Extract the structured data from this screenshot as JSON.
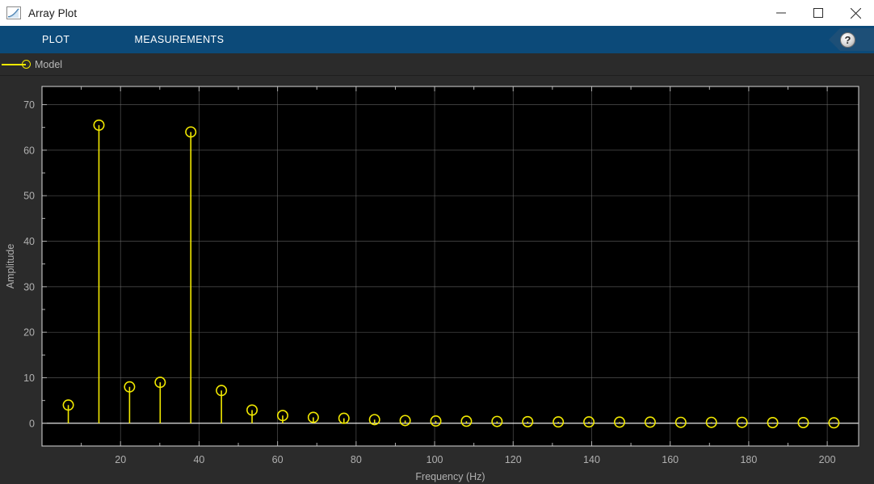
{
  "window": {
    "title": "Array Plot",
    "icon": "plot-curve-icon",
    "controls": {
      "minimize": "minimize-icon",
      "maximize": "maximize-icon",
      "close": "close-icon"
    }
  },
  "toolstrip": {
    "background": "#0c4a79",
    "tabs": [
      {
        "id": "plot",
        "label": "PLOT"
      },
      {
        "id": "measurements",
        "label": "MEASUREMENTS"
      }
    ],
    "help": {
      "icon": "help-question-icon",
      "label": "?"
    }
  },
  "legend": {
    "entries": [
      {
        "label": "Model",
        "color": "#f2e900",
        "marker": "circle"
      }
    ]
  },
  "chart_data": {
    "type": "line",
    "style": "stem",
    "title": "",
    "xlabel": "Frequency (Hz)",
    "ylabel": "Amplitude",
    "xlim": [
      0,
      208
    ],
    "ylim": [
      -5,
      74
    ],
    "grid": true,
    "legend_position": "top-left",
    "background": "#000000",
    "axis_background": "#2b2b2b",
    "grid_color": "#6e6e6e",
    "series_color": "#f2e900",
    "baseline_color": "#ffffff",
    "xticks": [
      20,
      40,
      60,
      80,
      100,
      120,
      140,
      160,
      180,
      200
    ],
    "xminor_step": 10,
    "yticks": [
      0,
      10,
      20,
      30,
      40,
      50,
      60,
      70
    ],
    "yminor_step": 5,
    "series": [
      {
        "name": "Model",
        "x": [
          6.7,
          14.5,
          22.3,
          30.1,
          37.9,
          45.7,
          53.5,
          61.3,
          69.1,
          76.9,
          84.7,
          92.5,
          100.3,
          108.1,
          115.9,
          123.7,
          131.5,
          139.3,
          147.1,
          154.9,
          162.7,
          170.5,
          178.3,
          186.1,
          193.9,
          201.7
        ],
        "y": [
          4.0,
          65.5,
          8.0,
          9.0,
          64.0,
          7.2,
          2.9,
          1.7,
          1.3,
          1.1,
          0.8,
          0.6,
          0.5,
          0.45,
          0.4,
          0.35,
          0.3,
          0.3,
          0.25,
          0.25,
          0.2,
          0.2,
          0.2,
          0.15,
          0.15,
          0.1
        ]
      }
    ]
  }
}
